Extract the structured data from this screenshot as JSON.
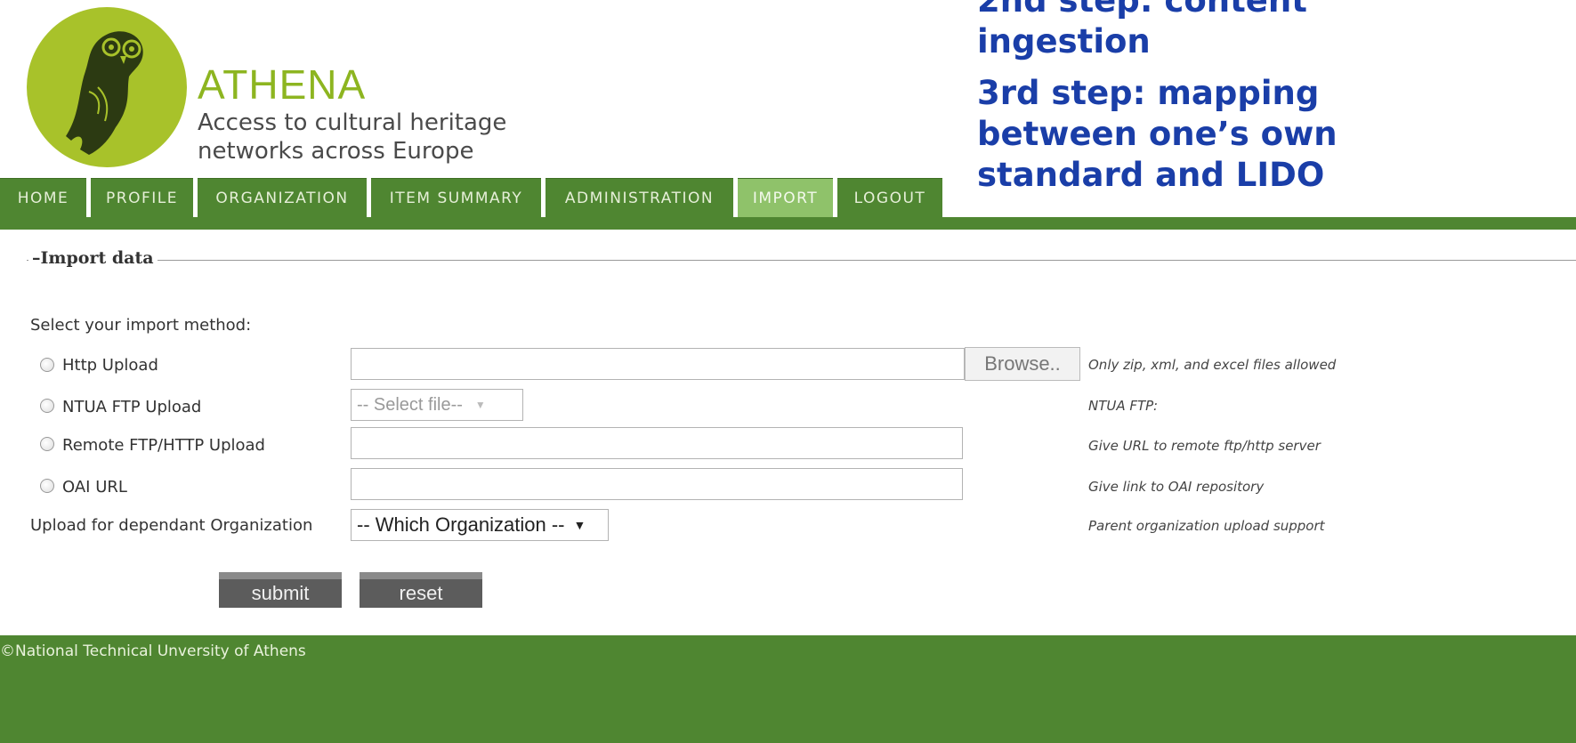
{
  "header": {
    "brand_title": "ATHENA",
    "brand_sub_line1": "Access to cultural heritage",
    "brand_sub_line2": "networks across Europe"
  },
  "overlay_steps": [
    "2nd step: content ingestion",
    "3rd step: mapping between one’s own standard and LIDO"
  ],
  "nav": {
    "tabs": [
      {
        "label": "HOME",
        "active": false
      },
      {
        "label": "PROFILE",
        "active": false
      },
      {
        "label": "ORGANIZATION",
        "active": false
      },
      {
        "label": "ITEM SUMMARY",
        "active": false
      },
      {
        "label": "ADMINISTRATION",
        "active": false
      },
      {
        "label": "IMPORT",
        "active": true
      },
      {
        "label": "LOGOUT",
        "active": false
      }
    ]
  },
  "form": {
    "legend": "Import data",
    "prompt": "Select your import method:",
    "methods": {
      "http": {
        "label": "Http Upload",
        "hint": "Only zip, xml, and excel files allowed",
        "browse_label": "Browse.."
      },
      "ntua": {
        "label": "NTUA FTP Upload",
        "select_value": "-- Select file--",
        "hint": "NTUA FTP:"
      },
      "remote": {
        "label": "Remote FTP/HTTP Upload",
        "hint": "Give URL to remote ftp/http server"
      },
      "oai": {
        "label": "OAI URL",
        "hint": "Give link to OAI repository"
      }
    },
    "dependant": {
      "label": "Upload for dependant Organization",
      "select_value": "-- Which Organization --",
      "hint": "Parent organization upload support"
    },
    "submit_label": "submit",
    "reset_label": "reset"
  },
  "footer": {
    "text": "©National Technical Unversity of Athens"
  },
  "colors": {
    "nav_green": "#4f8631",
    "active_tab": "#8fc26a",
    "brand_green": "#8db520",
    "steps_blue": "#1a3ea8"
  }
}
